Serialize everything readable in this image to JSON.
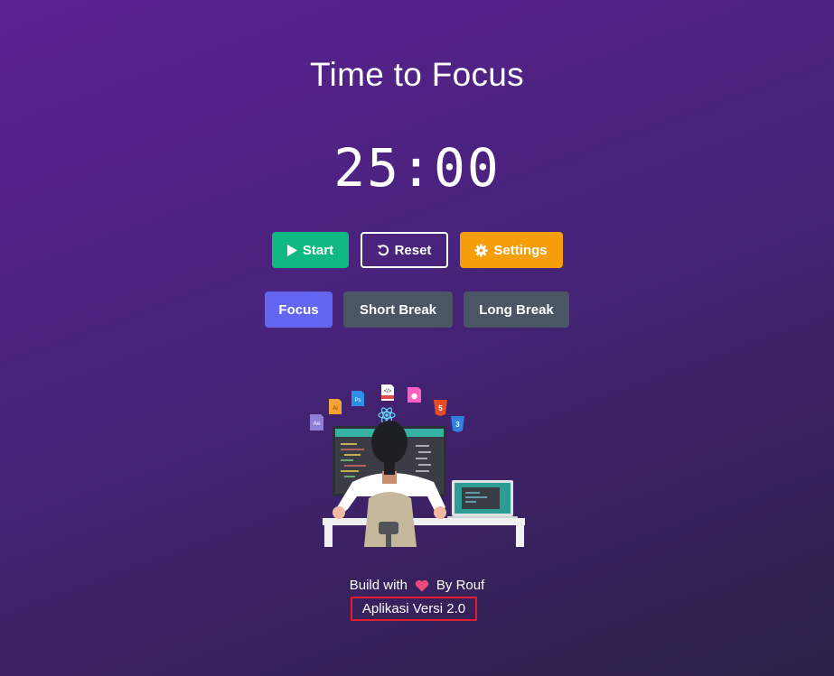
{
  "page": {
    "title": "Time to Focus"
  },
  "timer": {
    "display": "25:00"
  },
  "controls": {
    "start_label": "Start",
    "reset_label": "Reset",
    "settings_label": "Settings"
  },
  "modes": [
    {
      "label": "Focus",
      "active": true
    },
    {
      "label": "Short Break",
      "active": false
    },
    {
      "label": "Long Break",
      "active": false
    }
  ],
  "illustration": {
    "icons": [
      "after-effects-icon",
      "illustrator-icon",
      "photoshop-icon",
      "code-file-icon",
      "xd-icon",
      "html5-icon",
      "css3-icon",
      "react-icon"
    ]
  },
  "footer": {
    "build_prefix": "Build with",
    "heart_icon": "heart-icon",
    "build_suffix": "By Rouf",
    "version": "Aplikasi Versi 2.0"
  },
  "colors": {
    "start": "#10b981",
    "settings": "#f59e0b",
    "mode_active": "#6366f1",
    "mode_inactive": "#4b5563",
    "highlight_box": "#e11d2e"
  }
}
